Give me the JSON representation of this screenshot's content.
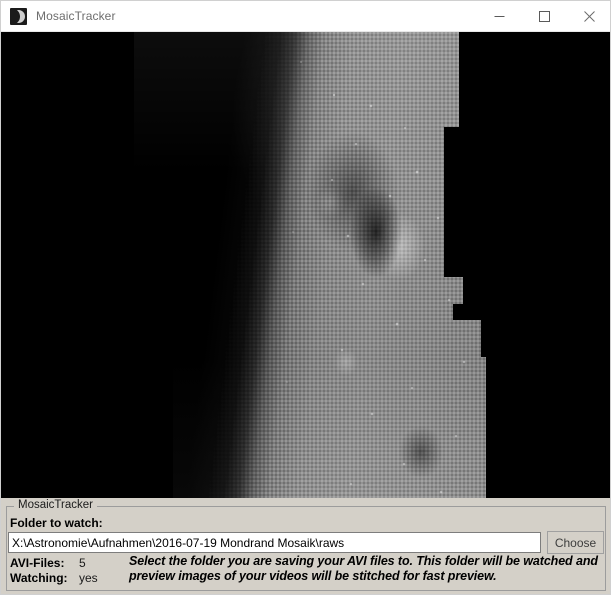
{
  "window": {
    "title": "MosaicTracker",
    "icon": "moon-icon",
    "controls": {
      "minimize": "minimize-icon",
      "maximize": "maximize-icon",
      "close": "close-icon"
    }
  },
  "preview": {
    "name": "mosaic-preview-canvas",
    "description": "Stitched lunar limb mosaic preview, black background"
  },
  "panel": {
    "group_title": "MosaicTracker",
    "folder_label": "Folder to watch:",
    "folder_path": "X:\\Astronomie\\Aufnahmen\\2016-07-19 Mondrand Mosaik\\raws",
    "folder_placeholder": "X:\\Astronomie\\Aufnahmen\\2016-07-19 Mondrand Mosaik\\raws",
    "choose_button": "Choose",
    "stats": [
      {
        "label": "AVI-Files:",
        "value": "5"
      },
      {
        "label": "Watching:",
        "value": "yes"
      }
    ],
    "hint_line_1": "Select the folder you are saving your AVI files to.   This folder will be watched and",
    "hint_line_2": "preview images of your videos will be stitched for fast preview."
  },
  "colors": {
    "titlebar_bg": "#ffffff",
    "title_text": "#6e6e6e",
    "panel_bg": "#d4d0c8",
    "canvas_bg": "#000000",
    "input_bg": "#ffffff",
    "border": "#9c9c9c"
  }
}
